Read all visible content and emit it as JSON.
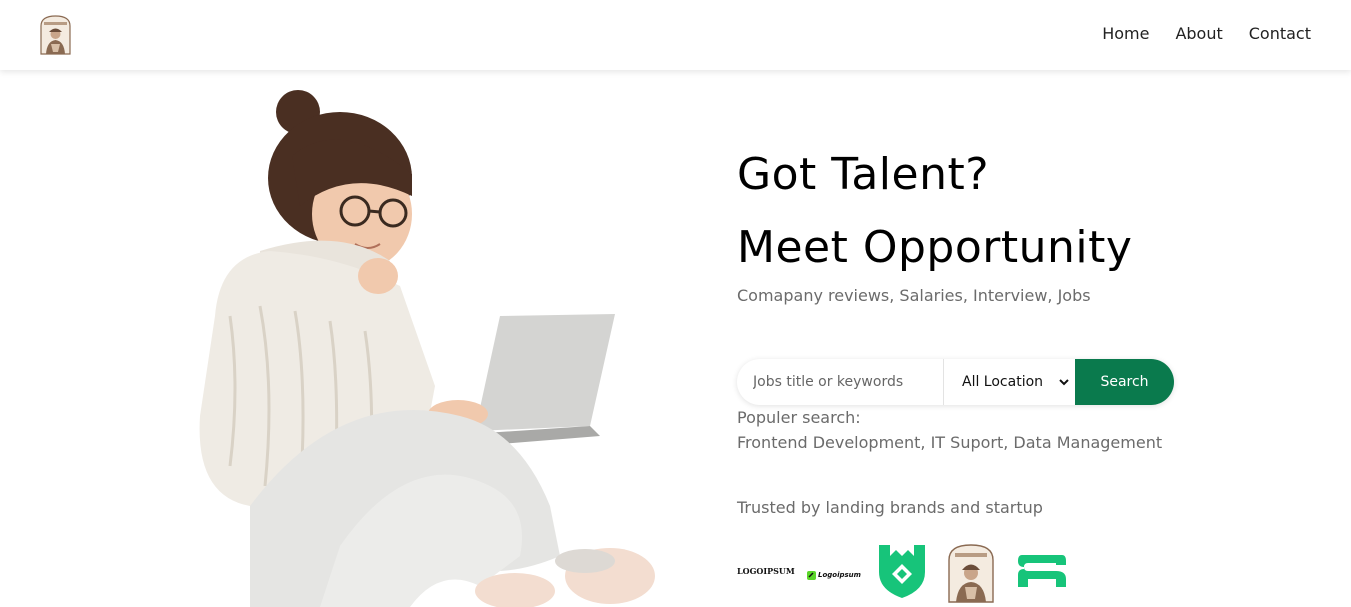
{
  "nav": {
    "logo_icon": "vintage-portrait-logo-icon",
    "links": [
      "Home",
      "About",
      "Contact"
    ]
  },
  "hero": {
    "headline_line1": "Got Talent?",
    "headline_line2": "Meet Opportunity",
    "subtitle": "Comapany reviews, Salaries, Interview, Jobs",
    "image_icon": "woman-with-laptop-illustration"
  },
  "search": {
    "placeholder": "Jobs title or keywords",
    "location_value": "All Location",
    "button_label": "Search"
  },
  "popular": {
    "label": "Populer search:",
    "items": "Frontend Development, IT Suport, Data Management"
  },
  "trusted": {
    "label": "Trusted by landing brands and startup",
    "brands": [
      "LOGOIPSUM",
      "Logoipsum",
      "shield-logo",
      "vintage-portrait-logo",
      "S-shape-logo"
    ]
  },
  "colors": {
    "accent": "#0a7a4d",
    "brand_green": "#17c47a"
  }
}
